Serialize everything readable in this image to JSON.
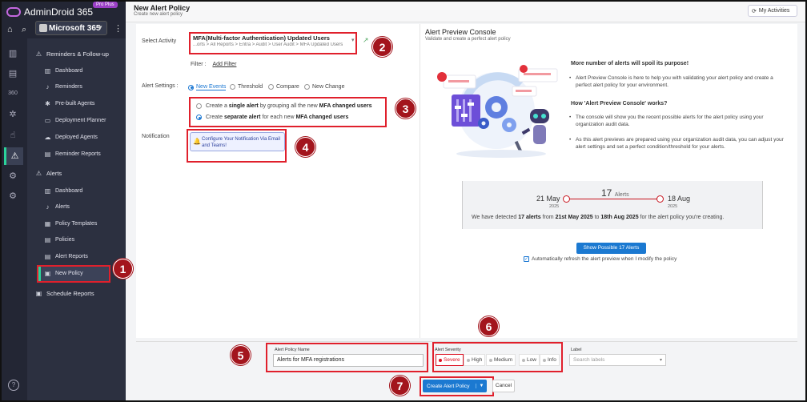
{
  "app": {
    "name": "AdminDroid 365",
    "plan_badge": "Pro Plus",
    "tenant": "Microsoft 365"
  },
  "nav": {
    "sections": [
      {
        "label": "Reminders & Follow-up",
        "items": [
          "Dashboard",
          "Reminders",
          "Pre-built Agents",
          "Deployment Planner",
          "Deployed Agents",
          "Reminder Reports"
        ]
      },
      {
        "label": "Alerts",
        "items": [
          "Dashboard",
          "Alerts",
          "Policy Templates",
          "Policies",
          "Alert Reports",
          "New Policy"
        ]
      },
      {
        "label": "Schedule Reports",
        "items": []
      }
    ]
  },
  "header": {
    "title": "New Alert Policy",
    "subtitle": "Create new alert policy",
    "my_activities": "My Activities"
  },
  "form": {
    "activity_label": "Select Activity",
    "activity_title": "MFA(Multi-factor Authentication) Updated Users",
    "activity_path": "...orts > All Reports > Entra > Audit > User Audit > MFA Updated Users",
    "filter_label": "Filter :",
    "add_filter": "Add Filter",
    "settings_label": "Alert Settings :",
    "tabs": [
      "New Events",
      "Threshold",
      "Compare",
      "New Change"
    ],
    "option1": {
      "a": "Create a ",
      "b": "single alert",
      "c": " by grouping all the new ",
      "d": "MFA changed users"
    },
    "option2": {
      "a": "Create ",
      "b": "separate alert",
      "c": " for each new ",
      "d": "MFA changed users"
    },
    "notification_label": "Notification",
    "notification_button": "Configure Your Notification Via Email and Teams!"
  },
  "preview": {
    "title": "Alert Preview Console",
    "subtitle": "Validate and create a perfect alert policy",
    "heading1": "More number of alerts will spoil its purpose!",
    "bullet1": "Alert Preview Console is here to help you with validating your alert policy and create a perfect alert policy for your environment.",
    "heading2": "How 'Alert Preview Console' works?",
    "bullet2": "The console will show you the recent possible alerts for the alert policy using your organization audit data.",
    "bullet3": "As this alert previews are prepared using your organization audit data, you can adjust your alert settings and set a perfect condition/threshold for your alerts.",
    "start_date": "21 May",
    "start_year": "2025",
    "end_date": "18 Aug",
    "end_year": "2025",
    "count": "17",
    "count_label": "Alerts",
    "msg_a": "We have detected ",
    "msg_b": "17 alerts",
    "msg_c": " from ",
    "msg_d": "21st May 2025",
    "msg_e": " to ",
    "msg_f": "18th Aug 2025",
    "msg_g": " for the alert policy you're creating.",
    "show_button": "Show Possible 17 Alerts",
    "auto_refresh": "Automatically refresh the alert preview when I modify the policy"
  },
  "bottom": {
    "name_label": "Alert Policy Name",
    "name_value": "Alerts for MFA registrations",
    "severity_label": "Alert Severity",
    "severities": [
      "Severe",
      "High",
      "Medium",
      "Low",
      "Info"
    ],
    "label_label": "Label",
    "label_placeholder": "Search labels",
    "create": "Create Alert Policy",
    "cancel": "Cancel"
  },
  "markers": [
    "1",
    "2",
    "3",
    "4",
    "5",
    "6",
    "7"
  ],
  "colors": {
    "accent": "#1b79d1",
    "highlight": "#e0202c",
    "marker": "#a3151d",
    "sidebar": "#2c3040",
    "active": "#2bd39a"
  }
}
